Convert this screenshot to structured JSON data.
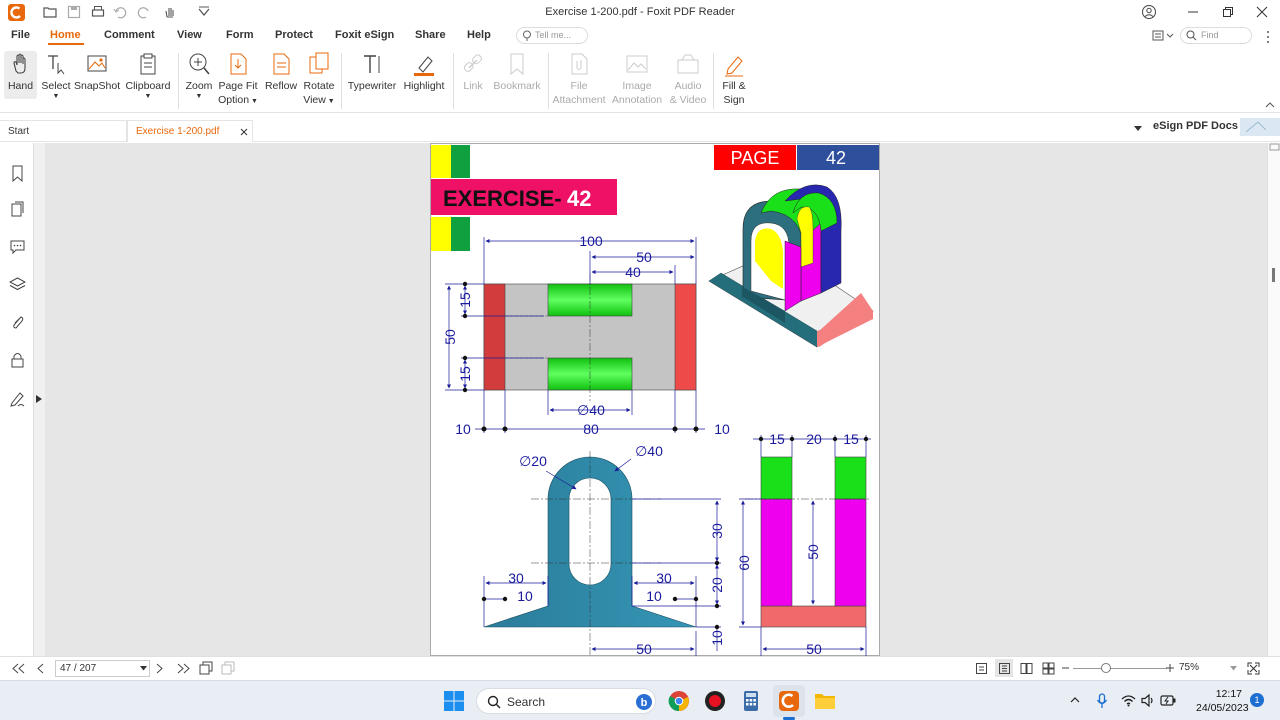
{
  "window": {
    "title": "Exercise 1-200.pdf - Foxit PDF Reader"
  },
  "menu": {
    "items": [
      "File",
      "Home",
      "Comment",
      "View",
      "Form",
      "Protect",
      "Foxit eSign",
      "Share",
      "Help"
    ],
    "active": "Home",
    "tell_me_placeholder": "Tell me...",
    "find_placeholder": "Find"
  },
  "ribbon": {
    "hand": "Hand",
    "select": "Select",
    "snapshot": "SnapShot",
    "clipboard": "Clipboard",
    "zoom": "Zoom",
    "page_fit_1": "Page Fit",
    "page_fit_2": "Option",
    "reflow": "Reflow",
    "rotate_1": "Rotate",
    "rotate_2": "View",
    "typewriter": "Typewriter",
    "highlight": "Highlight",
    "link": "Link",
    "bookmark": "Bookmark",
    "file_attachment_1": "File",
    "file_attachment_2": "Attachment",
    "image_annotation_1": "Image",
    "image_annotation_2": "Annotation",
    "audio_video_1": "Audio",
    "audio_video_2": "& Video",
    "fill_sign_1": "Fill &",
    "fill_sign_2": "Sign"
  },
  "tabs": {
    "start": "Start",
    "document": "Exercise 1-200.pdf"
  },
  "esign": {
    "label": "eSign PDF Docs"
  },
  "drawing": {
    "page_label": "PAGE",
    "page_number": "42",
    "exercise_word": "EXERCISE-",
    "exercise_number": "42",
    "dims_top": {
      "d100": "100",
      "d50": "50",
      "d40": "40",
      "d15a": "15",
      "d50v": "50",
      "d15b": "15",
      "dia40": "∅40",
      "d10l": "10",
      "d80": "80",
      "d10r": "10"
    },
    "dims_front": {
      "dia20": "∅20",
      "dia40": "∅40",
      "d30v": "30",
      "d20v": "20",
      "d10v": "10",
      "d30l": "30",
      "d10l": "10",
      "d30r": "30",
      "d10r": "10",
      "d50": "50"
    },
    "dims_side": {
      "d15a": "15",
      "d20": "20",
      "d15b": "15",
      "d60": "60",
      "d50v": "50",
      "d50": "50"
    }
  },
  "status": {
    "page_indicator": "47 / 207",
    "zoom": "75%"
  },
  "taskbar": {
    "search": "Search",
    "time": "12:17",
    "date": "24/05/2023",
    "notifications": "1"
  },
  "colors": {
    "accent": "#e8680c",
    "dim_blue": "#1a1a9c",
    "part_teal": "#2e87a6",
    "green": "#19e019",
    "magenta": "#ee00ee",
    "red_salmon": "#f07070"
  }
}
